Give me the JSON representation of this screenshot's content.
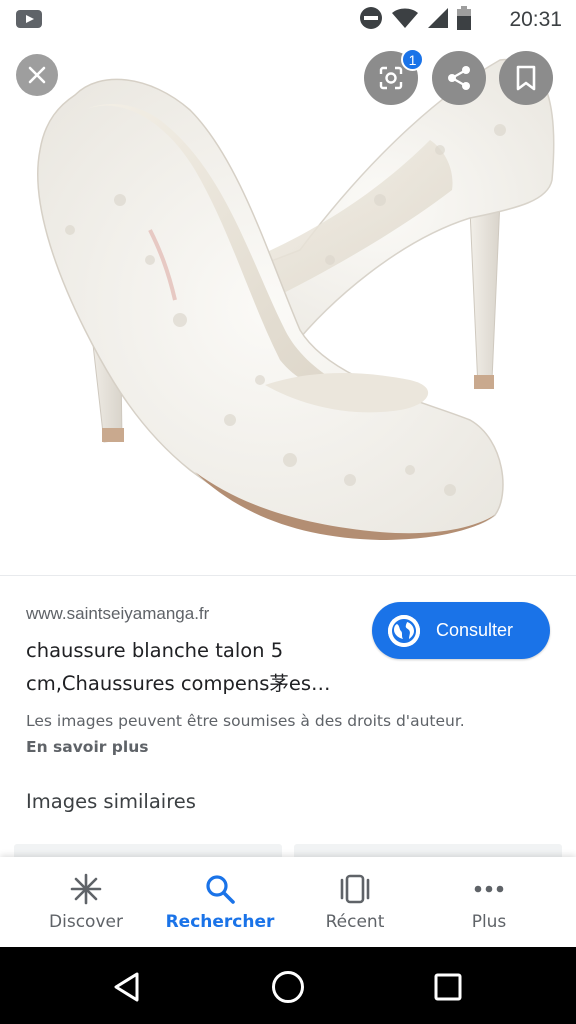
{
  "status_bar": {
    "time": "20:31",
    "icons": [
      "youtube-icon",
      "do-not-disturb-icon",
      "wifi-icon",
      "signal-icon",
      "battery-icon"
    ]
  },
  "overlay": {
    "close_icon": "close-icon",
    "lens_icon": "google-lens-icon",
    "lens_badge": "1",
    "share_icon": "share-icon",
    "save_icon": "bookmark-icon"
  },
  "result": {
    "source": "www.saintseiyamanga.fr",
    "title": "chaussure blanche talon 5 cm,Chaussures compens茅es…",
    "consult_label": "Consulter",
    "rights_notice": "Les images peuvent être soumises à des droits d'auteur.",
    "learn_more": "En savoir plus",
    "similar_heading": "Images similaires"
  },
  "bottom_nav": {
    "items": [
      {
        "label": "Discover",
        "icon": "asterisk-icon",
        "active": false
      },
      {
        "label": "Rechercher",
        "icon": "search-icon",
        "active": true
      },
      {
        "label": "Récent",
        "icon": "recent-tabs-icon",
        "active": false
      },
      {
        "label": "Plus",
        "icon": "more-dots-icon",
        "active": false
      }
    ]
  },
  "system_nav": {
    "back_icon": "back-triangle-icon",
    "home_icon": "home-circle-icon",
    "recents_icon": "recents-square-icon"
  },
  "colors": {
    "accent": "#1a73e8",
    "text_secondary": "#5f6368",
    "overlay_button": "#8c8c8c"
  }
}
